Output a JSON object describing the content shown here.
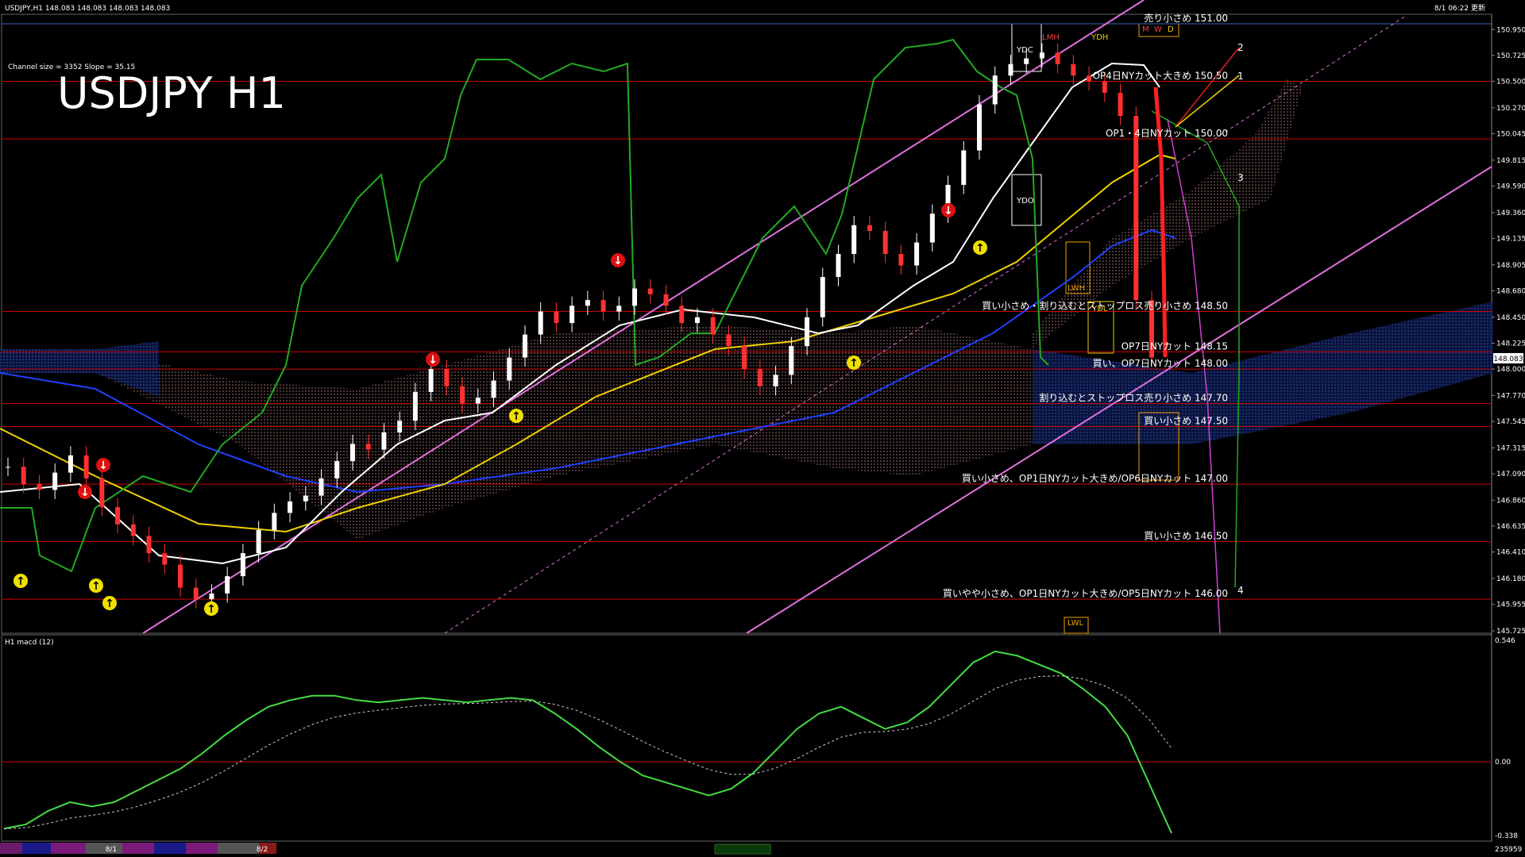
{
  "header": {
    "symbol_info": "USDJPY,H1  148.083 148.083 148.083 148.083",
    "update_time": "8/1 06:22 更新",
    "channel_info": "Channel size = 3352 Slope = 35.15",
    "big_title": "USDJPY H1"
  },
  "macd_panel": {
    "label": "H1  macd (12)",
    "ticks": [
      "0.546",
      "0.00",
      "-0.338"
    ]
  },
  "colors": {
    "background": "#000000",
    "resistance": "#cc0000",
    "price_label": "#ffffff",
    "ichimoku_cloud": "#1a3a8a",
    "channel": "#e070e0",
    "sma_white": "#ffffff",
    "sma_yellow": "#f0d000",
    "sma_blue": "#2040ff",
    "chikou": "#22aa22",
    "macd_up": "#44dd44",
    "macd_down": "#f090b0"
  },
  "chart_data": {
    "type": "line",
    "title": "USDJPY H1",
    "symbol": "USDJPY",
    "timeframe": "H1",
    "last_price": "148.083",
    "y_ticks": [
      "150.950",
      "150.725",
      "150.500",
      "150.270",
      "150.045",
      "149.815",
      "149.590",
      "149.360",
      "149.135",
      "148.905",
      "148.680",
      "148.450",
      "148.225",
      "148.000",
      "147.770",
      "147.545",
      "147.315",
      "147.090",
      "146.860",
      "146.635",
      "146.410",
      "146.180",
      "145.955",
      "145.725"
    ],
    "ylim": [
      145.725,
      151.0
    ],
    "price_series": {
      "name": "USDJPY close",
      "values": [
        147.15,
        147.0,
        146.95,
        147.1,
        147.25,
        147.05,
        146.8,
        146.65,
        146.55,
        146.4,
        146.3,
        146.1,
        146.0,
        146.05,
        146.2,
        146.4,
        146.6,
        146.75,
        146.85,
        146.9,
        147.05,
        147.2,
        147.35,
        147.3,
        147.45,
        147.55,
        147.8,
        148.0,
        147.85,
        147.7,
        147.75,
        147.9,
        148.1,
        148.3,
        148.5,
        148.4,
        148.55,
        148.6,
        148.5,
        148.55,
        148.7,
        148.65,
        148.55,
        148.4,
        148.45,
        148.3,
        148.2,
        148.0,
        147.85,
        147.95,
        148.2,
        148.45,
        148.8,
        149.0,
        149.25,
        149.2,
        149.0,
        148.9,
        149.1,
        149.35,
        149.6,
        149.9,
        150.3,
        150.55,
        150.65,
        150.7,
        150.75,
        150.65,
        150.55,
        150.5,
        150.4,
        150.2,
        148.6,
        148.1
      ]
    },
    "levels": [
      {
        "label": "売り小さめ 151.00",
        "value": 151.0
      },
      {
        "label": "OP4日NYカット大きめ 150.50",
        "value": 150.5
      },
      {
        "label": "OP1・4日NYカット 150.00",
        "value": 150.0
      },
      {
        "label": "買い小さめ・割り込むとストップロス売り小さめ 148.50",
        "value": 148.5
      },
      {
        "label": "OP7日NYカット 148.15",
        "value": 148.15
      },
      {
        "label": "買い、OP7日NYカット 148.00",
        "value": 148.0
      },
      {
        "label": "割り込むとストップロス売り小さめ 147.70",
        "value": 147.7
      },
      {
        "label": "買い小さめ 147.50",
        "value": 147.5
      },
      {
        "label": "買い小さめ、OP1日NYカット大きめ/OP6日NYカット 147.00",
        "value": 147.0
      },
      {
        "label": "買い小さめ 146.50",
        "value": 146.5
      },
      {
        "label": "買いやや小さめ、OP1日NYカット大きめ/OP5日NYカット 146.00",
        "value": 146.0
      }
    ],
    "box_labels": [
      "YDC",
      "YDO",
      "YDL",
      "LMH",
      "LWH",
      "LWL",
      "YDH",
      "M",
      "W",
      "D"
    ],
    "wave_labels": [
      "1",
      "2",
      "3",
      "4"
    ],
    "macd": {
      "name": "macd (12)",
      "ylim": [
        -0.338,
        0.546
      ],
      "values": [
        -0.3,
        -0.28,
        -0.22,
        -0.18,
        -0.2,
        -0.18,
        -0.13,
        -0.08,
        -0.03,
        0.04,
        0.12,
        0.19,
        0.25,
        0.28,
        0.3,
        0.3,
        0.28,
        0.27,
        0.28,
        0.29,
        0.28,
        0.27,
        0.28,
        0.29,
        0.28,
        0.22,
        0.15,
        0.07,
        0.0,
        -0.06,
        -0.09,
        -0.12,
        -0.15,
        -0.12,
        -0.05,
        0.05,
        0.15,
        0.22,
        0.25,
        0.2,
        0.15,
        0.18,
        0.25,
        0.35,
        0.45,
        0.5,
        0.48,
        0.44,
        0.4,
        0.33,
        0.25,
        0.12,
        -0.1,
        -0.32
      ]
    },
    "session_labels": [
      "8/1",
      "8/2"
    ],
    "volume_label": "235959"
  }
}
